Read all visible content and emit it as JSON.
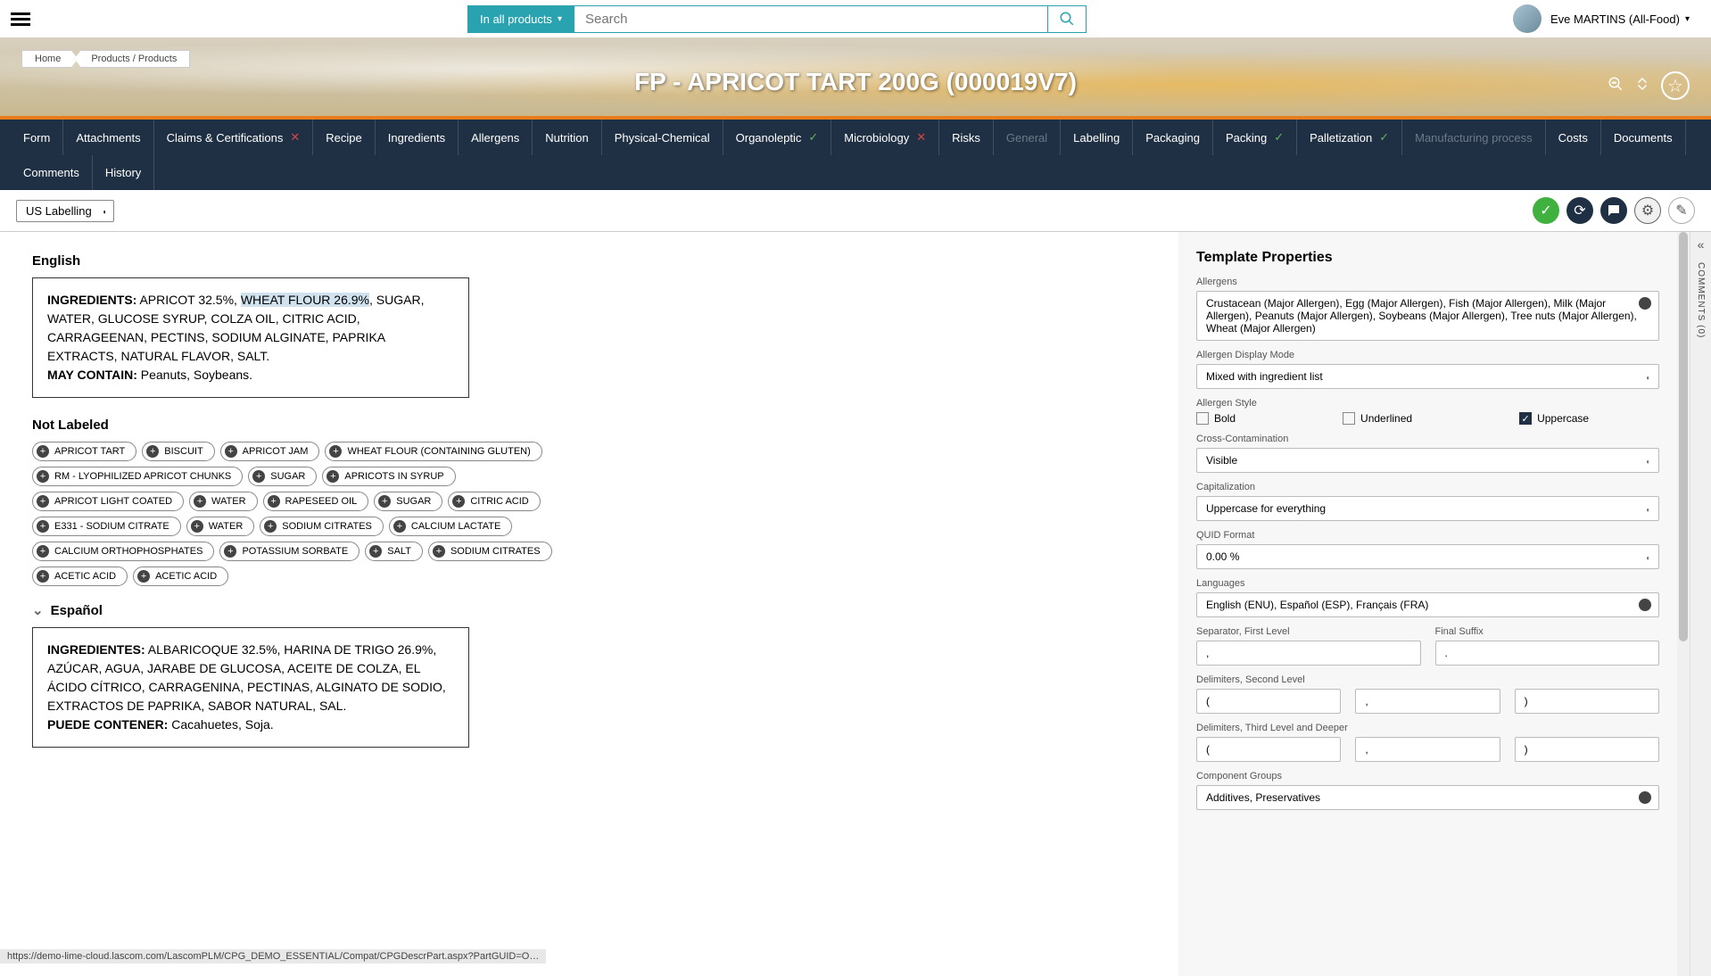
{
  "topbar": {
    "search_category": "In all products",
    "search_placeholder": "Search",
    "user_name": "Eve MARTINS (All-Food)"
  },
  "breadcrumbs": [
    "Home",
    "Products / Products"
  ],
  "page_title": "FP - APRICOT TART 200G (000019V7)",
  "tabs": [
    {
      "label": "Form"
    },
    {
      "label": "Attachments"
    },
    {
      "label": "Claims & Certifications",
      "mark": "x"
    },
    {
      "label": "Recipe"
    },
    {
      "label": "Ingredients"
    },
    {
      "label": "Allergens"
    },
    {
      "label": "Nutrition"
    },
    {
      "label": "Physical-Chemical"
    },
    {
      "label": "Organoleptic",
      "mark": "chk"
    },
    {
      "label": "Microbiology",
      "mark": "x"
    },
    {
      "label": "Risks"
    },
    {
      "label": "General",
      "disabled": true
    },
    {
      "label": "Labelling"
    },
    {
      "label": "Packaging"
    },
    {
      "label": "Packing",
      "mark": "chk"
    },
    {
      "label": "Palletization",
      "mark": "chk"
    },
    {
      "label": "Manufacturing process",
      "disabled": true
    },
    {
      "label": "Costs"
    },
    {
      "label": "Documents"
    },
    {
      "label": "Comments"
    },
    {
      "label": "History"
    }
  ],
  "labelling_dropdown": "US Labelling",
  "comments_rail": "COMMENTS (0)",
  "left": {
    "english_title": "English",
    "ing_label": "INGREDIENTS:",
    "ing_before": " APRICOT 32.5%, ",
    "ing_highlight": "WHEAT FLOUR 26.9%",
    "ing_after": ", SUGAR, WATER, GLUCOSE SYRUP, COLZA OIL, CITRIC ACID, CARRAGEENAN, PECTINS, SODIUM ALGINATE, PAPRIKA EXTRACTS, NATURAL FLAVOR, SALT.",
    "maycontain_label": "MAY CONTAIN:",
    "maycontain_text": " Peanuts, Soybeans.",
    "not_labeled_title": "Not Labeled",
    "chips": [
      "APRICOT TART",
      "BISCUIT",
      "APRICOT JAM",
      "WHEAT FLOUR (CONTAINING GLUTEN)",
      "RM - LYOPHILIZED APRICOT CHUNKS",
      "SUGAR",
      "APRICOTS IN SYRUP",
      "APRICOT LIGHT COATED",
      "WATER",
      "RAPESEED OIL",
      "SUGAR",
      "CITRIC ACID",
      "E331 - SODIUM CITRATE",
      "WATER",
      "SODIUM CITRATES",
      "CALCIUM LACTATE",
      "CALCIUM ORTHOPHOSPHATES",
      "POTASSIUM SORBATE",
      "SALT",
      "SODIUM CITRATES",
      "ACETIC ACID",
      "ACETIC ACID"
    ],
    "spanish_title": "Español",
    "sp_ing_label": "INGREDIENTES:",
    "sp_ing_text": " ALBARICOQUE 32.5%, HARINA DE TRIGO 26.9%, AZÚCAR, AGUA, JARABE DE GLUCOSA, ACEITE DE COLZA, EL ÁCIDO CÍTRICO, CARRAGENINA, PECTINAS, ALGINATO DE SODIO, EXTRACTOS DE PAPRIKA, SABOR NATURAL, SAL.",
    "sp_may_label": "PUEDE CONTENER:",
    "sp_may_text": " Cacahuetes, Soja."
  },
  "props": {
    "title": "Template Properties",
    "allergens_label": "Allergens",
    "allergens_value": "Crustacean (Major Allergen), Egg (Major Allergen), Fish (Major Allergen), Milk (Major Allergen), Peanuts (Major Allergen), Soybeans (Major Allergen), Tree nuts (Major Allergen), Wheat (Major Allergen)",
    "display_mode_label": "Allergen Display Mode",
    "display_mode_value": "Mixed with ingredient list",
    "style_label": "Allergen Style",
    "style_bold": "Bold",
    "style_underlined": "Underlined",
    "style_uppercase": "Uppercase",
    "cross_label": "Cross-Contamination",
    "cross_value": "Visible",
    "cap_label": "Capitalization",
    "cap_value": "Uppercase for everything",
    "quid_label": "QUID Format",
    "quid_value": "0.00 %",
    "lang_label": "Languages",
    "lang_value": "English (ENU), Español (ESP), Français (FRA)",
    "sep1_label": "Separator, First Level",
    "sep1_value": ",",
    "suffix_label": "Final Suffix",
    "suffix_value": ".",
    "delim2_label": "Delimiters, Second Level",
    "delim2_a": "(",
    "delim2_b": ",",
    "delim2_c": ")",
    "delim3_label": "Delimiters, Third Level and Deeper",
    "delim3_a": "(",
    "delim3_b": ",",
    "delim3_c": ")",
    "cgroups_label": "Component Groups",
    "cgroups_value": "Additives, Preservatives"
  },
  "status_url": "https://demo-lime-cloud.lascom.com/LascomPLM/CPG_DEMO_ESSENTIAL/Compat/CPGDescrPart.aspx?PartGUID=O…"
}
